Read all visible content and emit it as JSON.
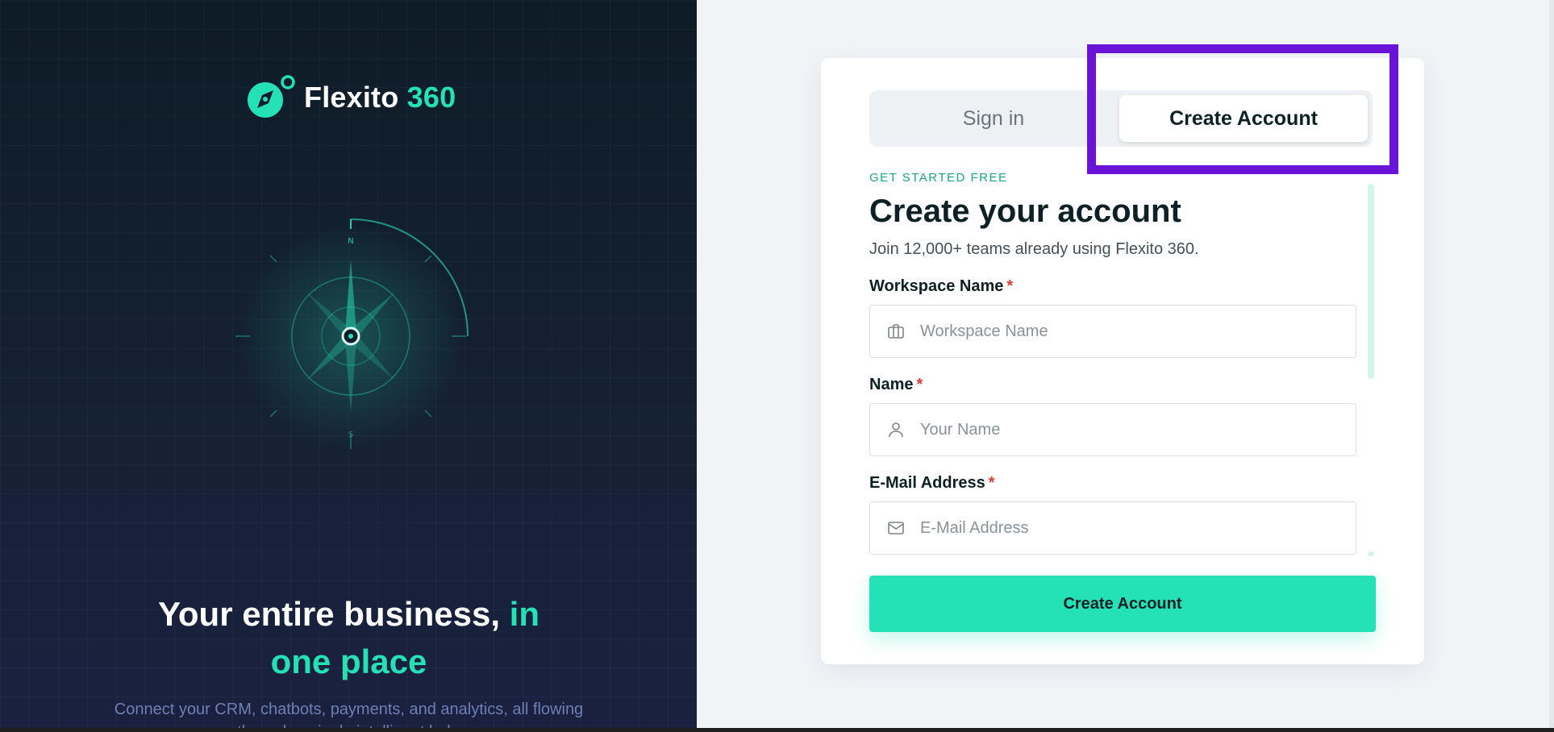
{
  "brand": {
    "name": "Flexito",
    "accent": "360",
    "logo_icon": "compass-icon"
  },
  "hero": {
    "headline_main": "Your entire business,",
    "headline_accent_1": "in",
    "headline_accent_2": "one place",
    "subtext": "Connect your CRM, chatbots, payments, and analytics, all flowing through a single intelligent hub."
  },
  "compass": {
    "north_label": "N",
    "south_label": "S"
  },
  "tabs": {
    "signin_label": "Sign in",
    "create_label": "Create Account",
    "active": "create"
  },
  "form": {
    "eyebrow": "GET STARTED FREE",
    "title": "Create your account",
    "description": "Join 12,000+ teams already using Flexito 360.",
    "required_mark": "*",
    "fields": [
      {
        "label": "Workspace Name",
        "placeholder": "Workspace Name",
        "icon": "briefcase-icon"
      },
      {
        "label": "Name",
        "placeholder": "Your Name",
        "icon": "user-icon"
      },
      {
        "label": "E-Mail Address",
        "placeholder": "E-Mail Address",
        "icon": "mail-icon"
      }
    ],
    "submit_label": "Create Account"
  },
  "colors": {
    "accent": "#25e2b6",
    "highlight": "#6a13d8",
    "required": "#e23a3a"
  }
}
